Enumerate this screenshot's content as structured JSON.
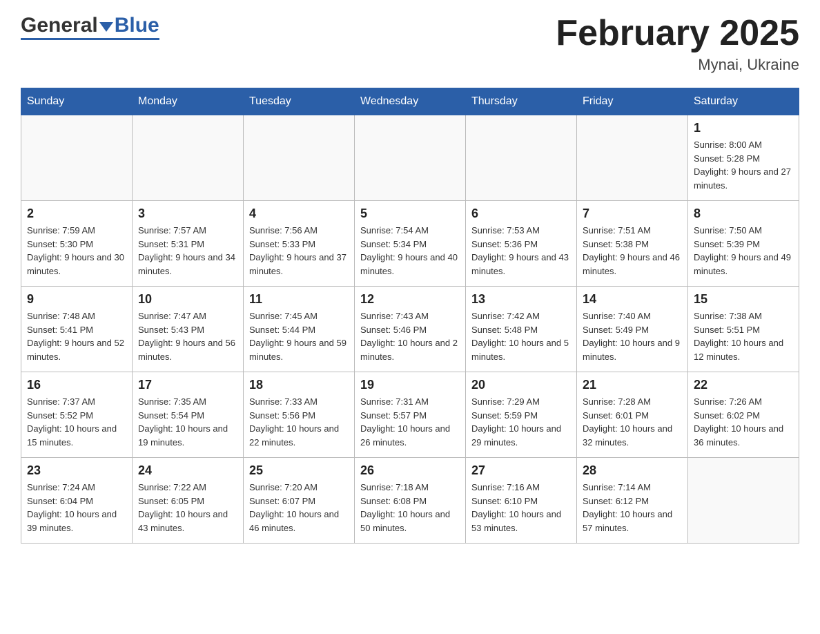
{
  "header": {
    "logo": {
      "general": "General",
      "blue": "Blue"
    },
    "title": "February 2025",
    "location": "Mynai, Ukraine"
  },
  "calendar": {
    "days_of_week": [
      "Sunday",
      "Monday",
      "Tuesday",
      "Wednesday",
      "Thursday",
      "Friday",
      "Saturday"
    ],
    "weeks": [
      [
        {
          "day": "",
          "info": ""
        },
        {
          "day": "",
          "info": ""
        },
        {
          "day": "",
          "info": ""
        },
        {
          "day": "",
          "info": ""
        },
        {
          "day": "",
          "info": ""
        },
        {
          "day": "",
          "info": ""
        },
        {
          "day": "1",
          "info": "Sunrise: 8:00 AM\nSunset: 5:28 PM\nDaylight: 9 hours and 27 minutes."
        }
      ],
      [
        {
          "day": "2",
          "info": "Sunrise: 7:59 AM\nSunset: 5:30 PM\nDaylight: 9 hours and 30 minutes."
        },
        {
          "day": "3",
          "info": "Sunrise: 7:57 AM\nSunset: 5:31 PM\nDaylight: 9 hours and 34 minutes."
        },
        {
          "day": "4",
          "info": "Sunrise: 7:56 AM\nSunset: 5:33 PM\nDaylight: 9 hours and 37 minutes."
        },
        {
          "day": "5",
          "info": "Sunrise: 7:54 AM\nSunset: 5:34 PM\nDaylight: 9 hours and 40 minutes."
        },
        {
          "day": "6",
          "info": "Sunrise: 7:53 AM\nSunset: 5:36 PM\nDaylight: 9 hours and 43 minutes."
        },
        {
          "day": "7",
          "info": "Sunrise: 7:51 AM\nSunset: 5:38 PM\nDaylight: 9 hours and 46 minutes."
        },
        {
          "day": "8",
          "info": "Sunrise: 7:50 AM\nSunset: 5:39 PM\nDaylight: 9 hours and 49 minutes."
        }
      ],
      [
        {
          "day": "9",
          "info": "Sunrise: 7:48 AM\nSunset: 5:41 PM\nDaylight: 9 hours and 52 minutes."
        },
        {
          "day": "10",
          "info": "Sunrise: 7:47 AM\nSunset: 5:43 PM\nDaylight: 9 hours and 56 minutes."
        },
        {
          "day": "11",
          "info": "Sunrise: 7:45 AM\nSunset: 5:44 PM\nDaylight: 9 hours and 59 minutes."
        },
        {
          "day": "12",
          "info": "Sunrise: 7:43 AM\nSunset: 5:46 PM\nDaylight: 10 hours and 2 minutes."
        },
        {
          "day": "13",
          "info": "Sunrise: 7:42 AM\nSunset: 5:48 PM\nDaylight: 10 hours and 5 minutes."
        },
        {
          "day": "14",
          "info": "Sunrise: 7:40 AM\nSunset: 5:49 PM\nDaylight: 10 hours and 9 minutes."
        },
        {
          "day": "15",
          "info": "Sunrise: 7:38 AM\nSunset: 5:51 PM\nDaylight: 10 hours and 12 minutes."
        }
      ],
      [
        {
          "day": "16",
          "info": "Sunrise: 7:37 AM\nSunset: 5:52 PM\nDaylight: 10 hours and 15 minutes."
        },
        {
          "day": "17",
          "info": "Sunrise: 7:35 AM\nSunset: 5:54 PM\nDaylight: 10 hours and 19 minutes."
        },
        {
          "day": "18",
          "info": "Sunrise: 7:33 AM\nSunset: 5:56 PM\nDaylight: 10 hours and 22 minutes."
        },
        {
          "day": "19",
          "info": "Sunrise: 7:31 AM\nSunset: 5:57 PM\nDaylight: 10 hours and 26 minutes."
        },
        {
          "day": "20",
          "info": "Sunrise: 7:29 AM\nSunset: 5:59 PM\nDaylight: 10 hours and 29 minutes."
        },
        {
          "day": "21",
          "info": "Sunrise: 7:28 AM\nSunset: 6:01 PM\nDaylight: 10 hours and 32 minutes."
        },
        {
          "day": "22",
          "info": "Sunrise: 7:26 AM\nSunset: 6:02 PM\nDaylight: 10 hours and 36 minutes."
        }
      ],
      [
        {
          "day": "23",
          "info": "Sunrise: 7:24 AM\nSunset: 6:04 PM\nDaylight: 10 hours and 39 minutes."
        },
        {
          "day": "24",
          "info": "Sunrise: 7:22 AM\nSunset: 6:05 PM\nDaylight: 10 hours and 43 minutes."
        },
        {
          "day": "25",
          "info": "Sunrise: 7:20 AM\nSunset: 6:07 PM\nDaylight: 10 hours and 46 minutes."
        },
        {
          "day": "26",
          "info": "Sunrise: 7:18 AM\nSunset: 6:08 PM\nDaylight: 10 hours and 50 minutes."
        },
        {
          "day": "27",
          "info": "Sunrise: 7:16 AM\nSunset: 6:10 PM\nDaylight: 10 hours and 53 minutes."
        },
        {
          "day": "28",
          "info": "Sunrise: 7:14 AM\nSunset: 6:12 PM\nDaylight: 10 hours and 57 minutes."
        },
        {
          "day": "",
          "info": ""
        }
      ]
    ]
  }
}
